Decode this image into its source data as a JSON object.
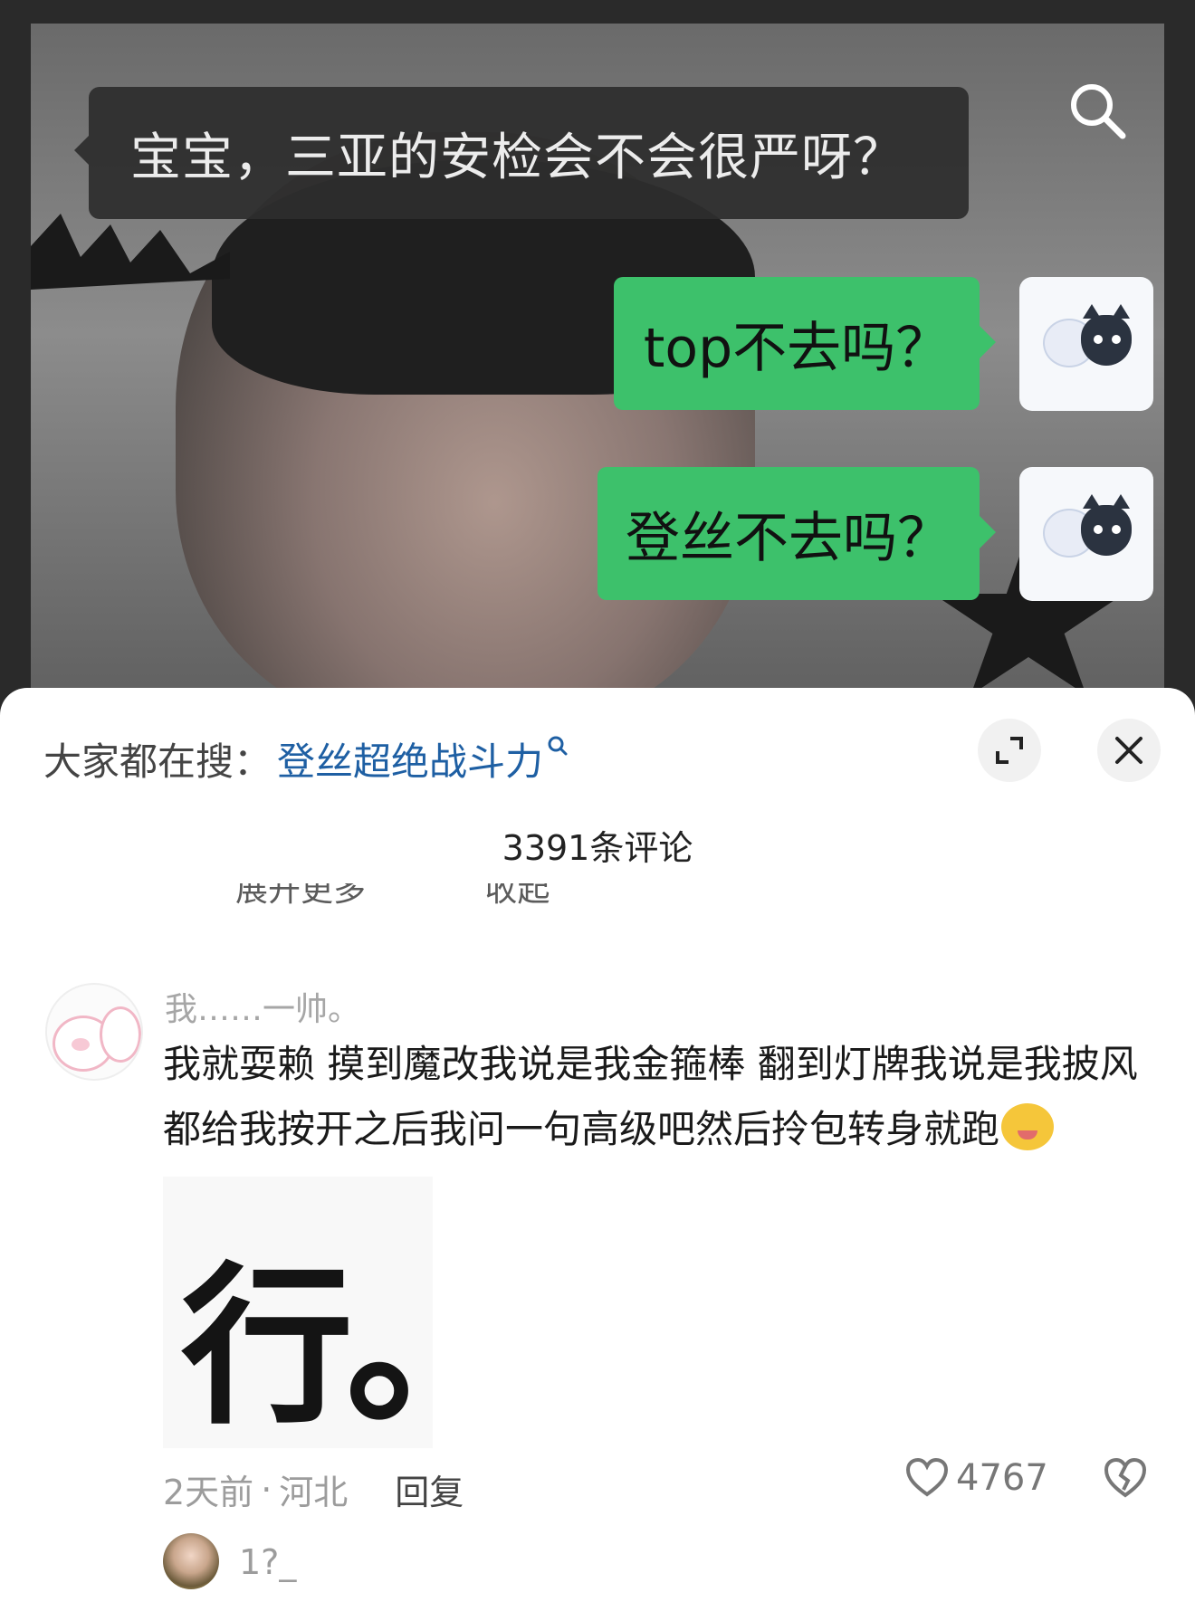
{
  "video": {
    "caption_question": "宝宝，三亚的安检会不会很严呀？",
    "reply_bubbles": [
      "top不去吗？",
      "登丝不去吗？"
    ],
    "search_icon": "search-icon"
  },
  "panel": {
    "search_prefix": "大家都在搜：",
    "search_term": "登丝超绝战斗力",
    "search_term_icon": "search-mini-icon",
    "expand_icon": "expand-icon",
    "close_icon": "close-icon",
    "comment_count": "3391条评论",
    "faded_items": [
      "展开更多",
      "收起"
    ]
  },
  "comment": {
    "username": "我……一帅。",
    "text": "我就耍赖 摸到魔改我说是我金箍棒 翻到灯牌我说是我披风 都给我按开之后我问一句高级吧然后拎包转身就跑",
    "emoji": "laughing-face-emoji",
    "sticker_text": "行。",
    "time": "2天前",
    "separator": "·",
    "location": "河北",
    "reply_label": "回复",
    "likes": "4767"
  },
  "reply": {
    "username": "1?_"
  },
  "colors": {
    "green_bubble": "#3dc16b",
    "link_blue": "#1e5fa3",
    "meta_gray": "#9c9c9c"
  }
}
